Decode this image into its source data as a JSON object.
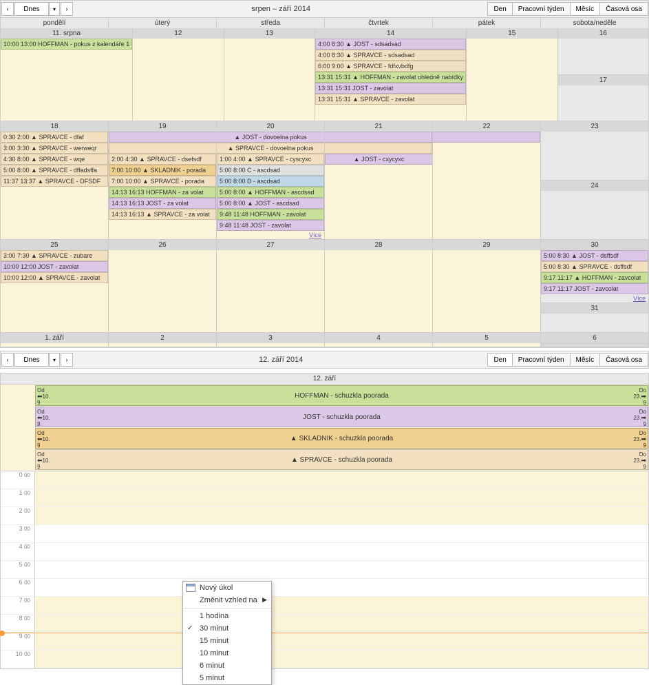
{
  "monthToolbar": {
    "today": "Dnes",
    "title": "srpen – září 2014",
    "views": {
      "day": "Den",
      "workweek": "Pracovní týden",
      "month": "Měsíc",
      "timeline": "Časová osa"
    }
  },
  "dayToolbar": {
    "today": "Dnes",
    "title": "12. září 2014",
    "views": {
      "day": "Den",
      "workweek": "Pracovní týden",
      "month": "Měsíc",
      "timeline": "Časová osa"
    }
  },
  "dayHeaders": [
    "pondělí",
    "úterý",
    "středa",
    "čtvrtek",
    "pátek",
    "sobota/neděle"
  ],
  "weeks": [
    {
      "dates": [
        "11. srpna",
        "12",
        "13",
        "14",
        "15",
        "16",
        "17"
      ],
      "cells": [
        [
          {
            "t": "10:00 13:00",
            "x": "HOFFMAN - pokus z kalendáře 1",
            "c": "c-green"
          }
        ],
        [],
        [],
        [
          {
            "t": "4:00 8:30",
            "x": "▲ JOST - sdsadsad",
            "c": "c-purple"
          },
          {
            "t": "4:00 8:30",
            "x": "▲ SPRAVCE - sdsadsad",
            "c": "c-beige"
          },
          {
            "t": "6:00 9:00",
            "x": "▲ SPRAVCE - fdfxvbdfg",
            "c": "c-beige"
          },
          {
            "t": "13:31 15:31",
            "x": "▲ HOFFMAN - zavolat ohledně nabídky",
            "c": "c-green"
          },
          {
            "t": "13:31 15:31",
            "x": "JOST - zavolat",
            "c": "c-purple"
          },
          {
            "t": "13:31 15:31",
            "x": "▲ SPRAVCE - zavolat",
            "c": "c-beige"
          }
        ],
        [],
        [],
        []
      ]
    },
    {
      "dates": [
        "18",
        "19",
        "20",
        "21",
        "22",
        "23",
        "24"
      ],
      "spanRows": [
        {
          "start": 1,
          "end": 3,
          "x": "▲ JOST - dovoelna pokus",
          "c": "c-purple"
        },
        {
          "start": 1,
          "end": 3,
          "x": "▲ SPRAVCE - dovoelna pokus",
          "c": "c-beige"
        }
      ],
      "spanRows2": [
        {
          "start": 3,
          "end": 4,
          "x": "▲ JOST - cxycyxc",
          "c": "c-purple"
        }
      ],
      "cells": [
        [
          {
            "t": "0:30 2:00",
            "x": "▲ SPRAVCE - dfaf",
            "c": "c-beige"
          },
          {
            "t": "3:00 3:30",
            "x": "▲ SPRAVCE - werweqr",
            "c": "c-beige"
          },
          {
            "t": "4:30 8:00",
            "x": "▲ SPRAVCE - wqe",
            "c": "c-beige"
          },
          {
            "t": "5:00 8:00",
            "x": "▲ SPRAVCE - dffadsffa",
            "c": "c-beige"
          },
          {
            "t": "11:37 13:37",
            "x": "▲ SPRAVCE - DFSDF",
            "c": "c-beige"
          }
        ],
        [
          {
            "t": "2:00 4:30",
            "x": "▲ SPRAVCE - dsefsdf",
            "c": "c-beige"
          },
          {
            "t": "7:00 10:00",
            "x": "▲ SKLADNIK - porada",
            "c": "c-beige",
            "sp": true
          },
          {
            "t": "7:00 10:00",
            "x": "▲ SPRAVCE - porada",
            "c": "c-beige"
          },
          {
            "t": "14:13 16:13",
            "x": "HOFFMAN - za volat",
            "c": "c-green"
          },
          {
            "t": "14:13 16:13",
            "x": "JOST - za volat",
            "c": "c-purple"
          },
          {
            "t": "14:13 16:13",
            "x": "▲ SPRAVCE - za volat",
            "c": "c-beige"
          }
        ],
        [
          {
            "t": "1:00 4:00",
            "x": "▲ SPRAVCE - cyscyxc",
            "c": "c-beige"
          },
          {
            "t": "5:00 8:00",
            "x": "C - ascdsad",
            "c": "c-gray"
          },
          {
            "t": "5:00 8:00",
            "x": "D - ascdsad",
            "c": "c-blue"
          },
          {
            "t": "5:00 8:00",
            "x": "▲ HOFFMAN - ascdsad",
            "c": "c-green"
          },
          {
            "t": "5:00 8:00",
            "x": "▲ JOST - ascdsad",
            "c": "c-purple"
          },
          {
            "t": "9:48 11:48",
            "x": "HOFFMAN - zavolat",
            "c": "c-green"
          },
          {
            "t": "9:48 11:48",
            "x": "JOST - zavolat",
            "c": "c-purple"
          }
        ],
        [],
        [],
        [],
        []
      ],
      "moreCol": 2,
      "moreLabel": "Více"
    },
    {
      "dates": [
        "25",
        "26",
        "27",
        "28",
        "29",
        "30",
        "31"
      ],
      "cells": [
        [
          {
            "t": "3:00 7:30",
            "x": "▲ SPRAVCE - zubare",
            "c": "c-beige"
          },
          {
            "t": "10:00 12:00",
            "x": "JOST - zavolat",
            "c": "c-purple"
          },
          {
            "t": "10:00 12:00",
            "x": "▲ SPRAVCE - zavolat",
            "c": "c-beige"
          }
        ],
        [],
        [],
        [],
        [],
        [
          {
            "t": "5:00 8:30",
            "x": "▲ JOST - dsffsdf",
            "c": "c-purple"
          },
          {
            "t": "5:00 8:30",
            "x": "▲ SPRAVCE - dsffsdf",
            "c": "c-beige"
          },
          {
            "t": "9:17 11:17",
            "x": "▲ HOFFMAN - zavcolat",
            "c": "c-green"
          },
          {
            "t": "9:17 11:17",
            "x": "JOST - zavcolat",
            "c": "c-purple"
          }
        ],
        []
      ],
      "moreCol": 5,
      "moreLabel": "Více"
    },
    {
      "dates": [
        "1. září",
        "2",
        "3",
        "4",
        "5",
        "6",
        ""
      ],
      "cells": [
        [],
        [],
        [],
        [],
        [],
        [],
        []
      ]
    }
  ],
  "dayView": {
    "headerDate": "12. září",
    "fromLabel": "Od",
    "toLabel": "Do",
    "fromDate": "10. 9",
    "toDate": "23. 9",
    "allday": [
      {
        "x": "HOFFMAN - schuzkla poorada",
        "c": "c-green"
      },
      {
        "x": "JOST - schuzkla poorada",
        "c": "c-purple"
      },
      {
        "x": "▲ SKLADNIK - schuzkla poorada",
        "c": "c-beige",
        "sp": true
      },
      {
        "x": "▲ SPRAVCE - schuzkla poorada",
        "c": "c-beige"
      }
    ],
    "hours": [
      "0",
      "1",
      "2",
      "3",
      "4",
      "5",
      "6",
      "7",
      "8",
      "9",
      "10"
    ],
    "min": "00",
    "busyStart": 0,
    "busyEnd": 2,
    "busy2Start": 7,
    "busy2End": 99,
    "nowHour": 9
  },
  "ctx": {
    "newTask": "Nový úkol",
    "changeView": "Změnit vzhled na",
    "opts": [
      "1 hodina",
      "30 minut",
      "15 minut",
      "10 minut",
      "6 minut",
      "5 minut"
    ],
    "checked": 1
  }
}
